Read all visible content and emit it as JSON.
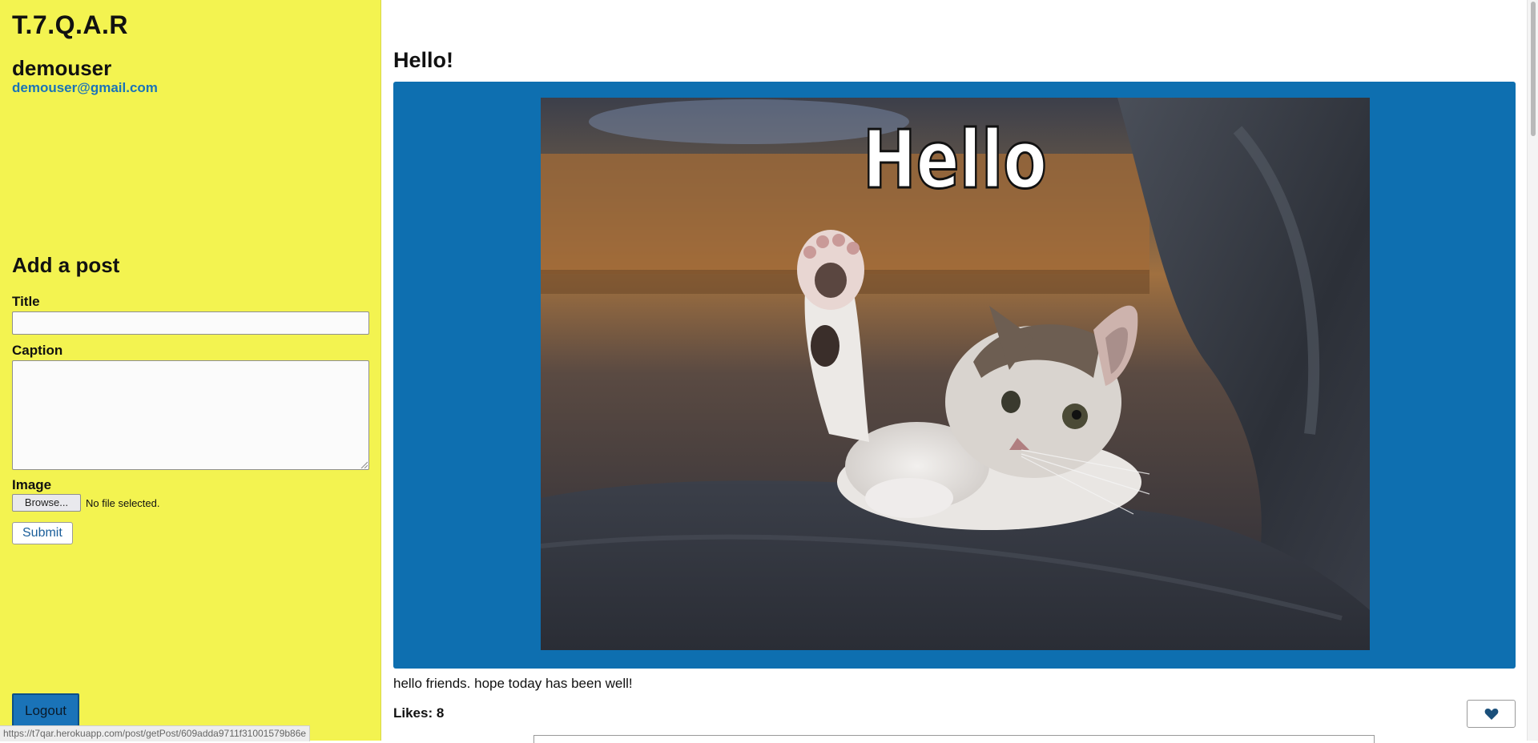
{
  "sidebar": {
    "brand": "T.7.Q.A.R",
    "username": "demouser",
    "email": "demouser@gmail.com",
    "add_post": {
      "heading": "Add a post",
      "title_label": "Title",
      "title_value": "",
      "caption_label": "Caption",
      "caption_value": "",
      "image_label": "Image",
      "browse_label": "Browse...",
      "file_status": "No file selected.",
      "submit_label": "Submit"
    },
    "logout_label": "Logout"
  },
  "status_bar": {
    "url": "https://t7qar.herokuapp.com/post/getPost/609adda9711f31001579b86e"
  },
  "post": {
    "title": "Hello!",
    "image_text": "Hello",
    "caption": "hello friends. hope today has been well!",
    "likes_text": "Likes: 8",
    "like_icon": "heart-icon"
  },
  "colors": {
    "sidebar_bg": "#f3f350",
    "accent_blue": "#0e6fb0",
    "email_blue": "#1a73b8"
  }
}
